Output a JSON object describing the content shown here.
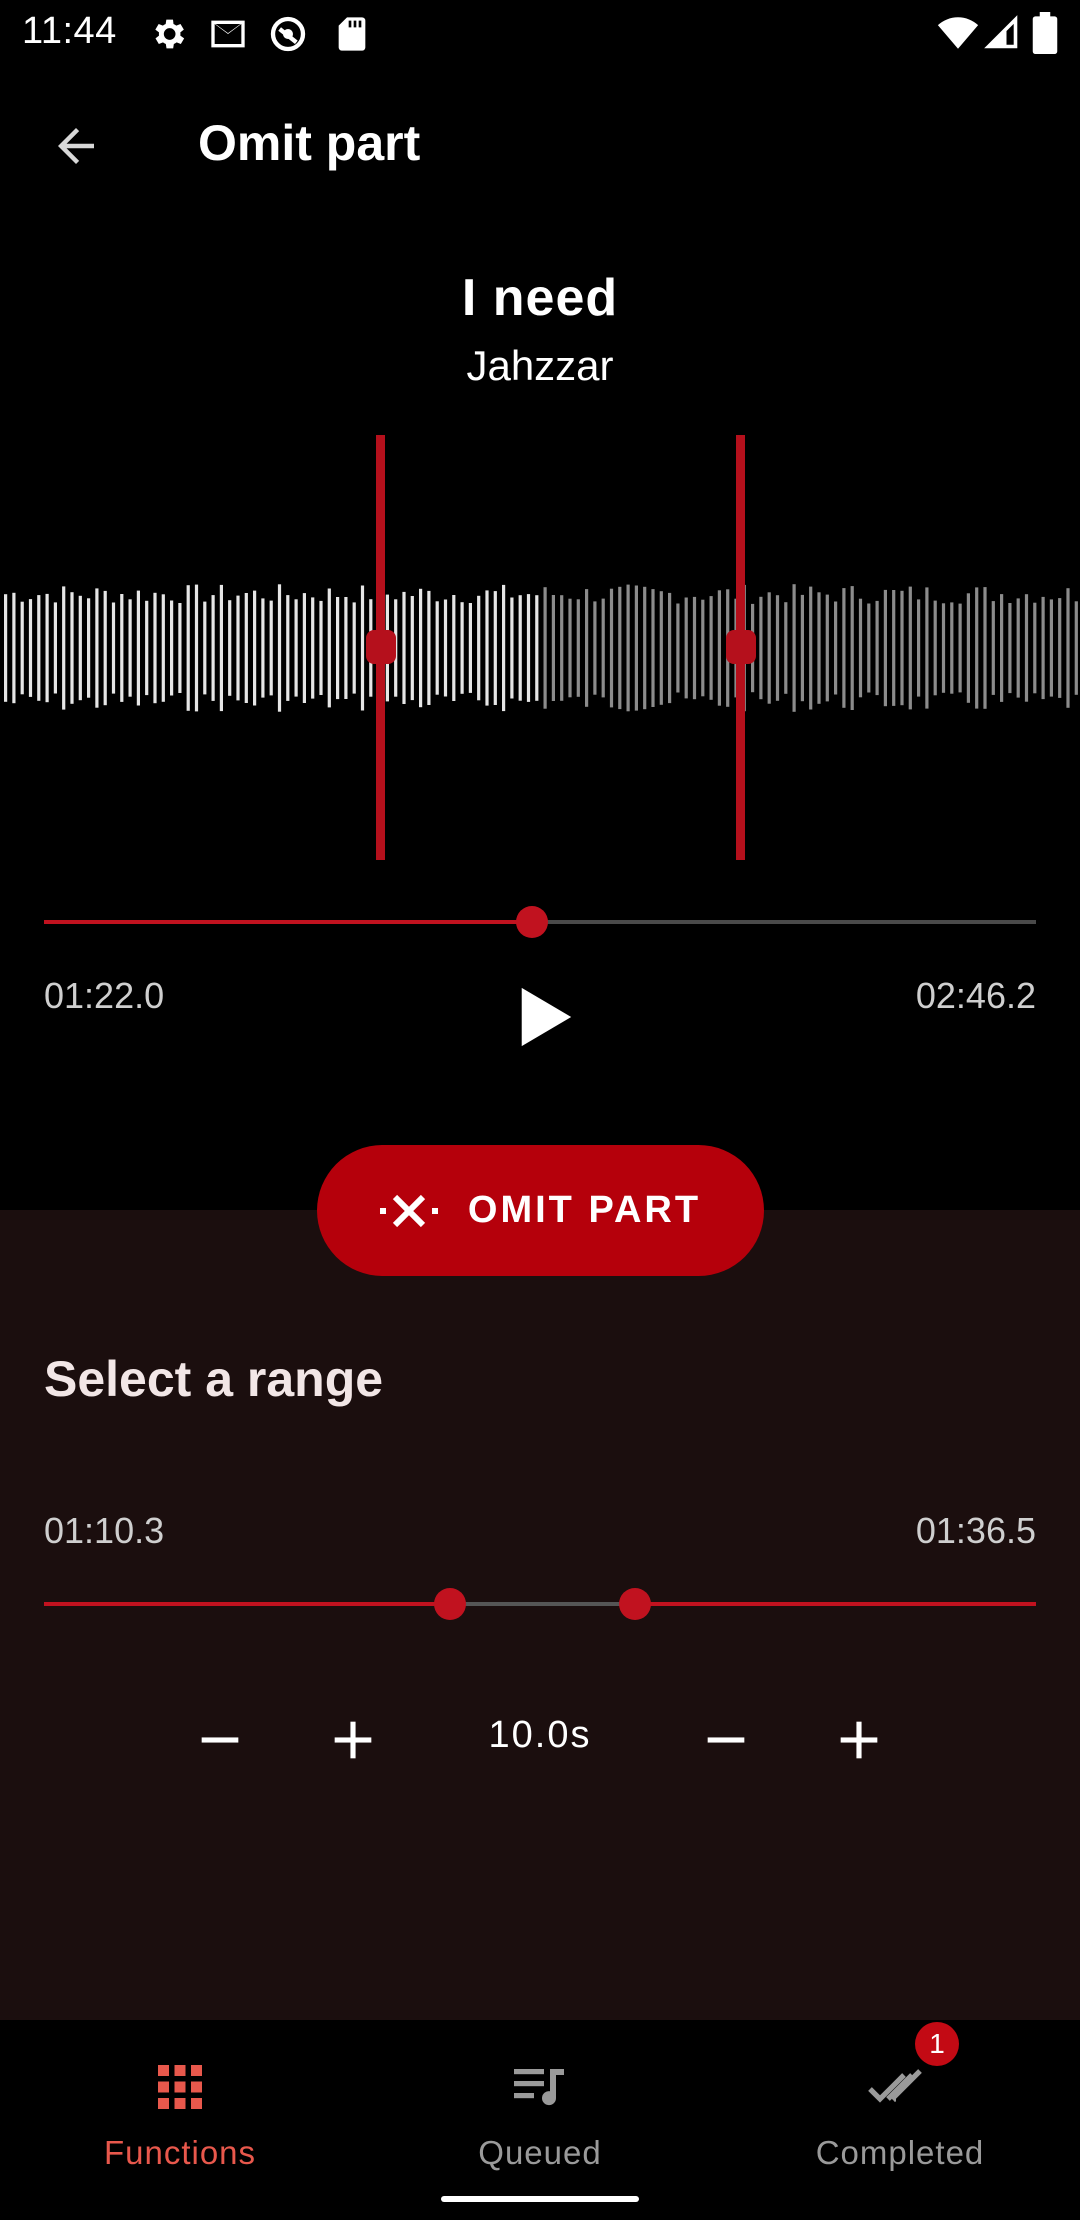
{
  "status_bar": {
    "time": "11:44",
    "left_icons": [
      "settings-icon",
      "gmail-icon",
      "vpn-icon",
      "sd-card-icon"
    ],
    "right_icons": [
      "wifi-icon",
      "signal-icon",
      "battery-icon"
    ]
  },
  "app_bar": {
    "back_icon": "arrow-back-icon",
    "title": "Omit part"
  },
  "song": {
    "title": "I need",
    "artist": "Jahzzar"
  },
  "player": {
    "current_time": "01:22.0",
    "total_time": "02:46.2",
    "progress": 0.49,
    "play_icon": "play-icon"
  },
  "waveform": {
    "marker_start_fraction": 0.352,
    "marker_end_fraction": 0.685,
    "played_fraction": 0.5
  },
  "action": {
    "omit_label": "OMIT PART",
    "omit_icon": "omit-x-icon"
  },
  "range": {
    "title": "Select a range",
    "start": "01:10.3",
    "end": "01:36.5",
    "start_fraction": 0.41,
    "end_fraction": 0.596,
    "step_value": "10.0s"
  },
  "nav": {
    "items": [
      {
        "label": "Functions",
        "icon": "grid-icon",
        "active": true
      },
      {
        "label": "Queued",
        "icon": "queue-music-icon",
        "active": false
      },
      {
        "label": "Completed",
        "icon": "done-all-icon",
        "active": false
      }
    ],
    "completed_badge": "1"
  },
  "colors": {
    "accent": "#b5000b",
    "accent_light": "#e8584c",
    "sheet_bg": "#1b0e0e",
    "background": "#000000"
  }
}
